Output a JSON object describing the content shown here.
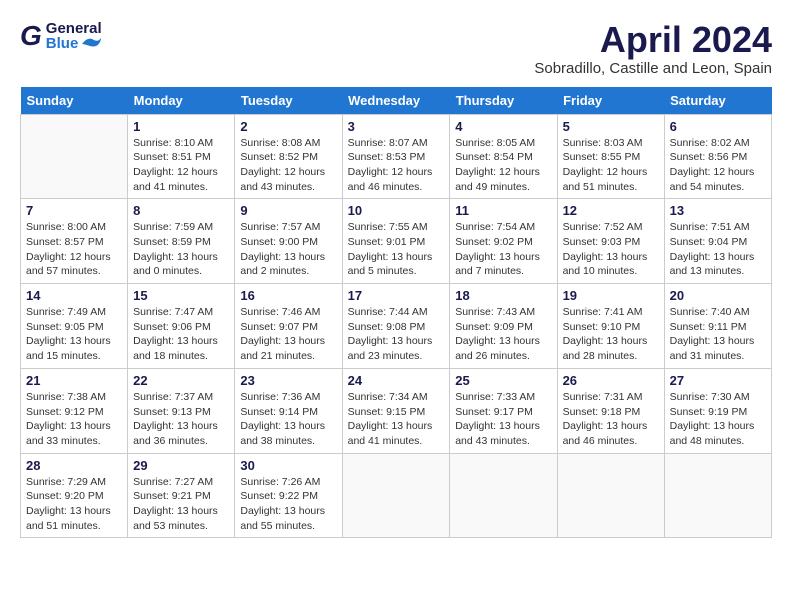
{
  "header": {
    "logo": {
      "general": "General",
      "blue": "Blue"
    },
    "title": "April 2024",
    "location": "Sobradillo, Castille and Leon, Spain"
  },
  "calendar": {
    "days_header": [
      "Sunday",
      "Monday",
      "Tuesday",
      "Wednesday",
      "Thursday",
      "Friday",
      "Saturday"
    ],
    "weeks": [
      [
        {
          "day": "",
          "sunrise": "",
          "sunset": "",
          "daylight": ""
        },
        {
          "day": "1",
          "sunrise": "Sunrise: 8:10 AM",
          "sunset": "Sunset: 8:51 PM",
          "daylight": "Daylight: 12 hours and 41 minutes."
        },
        {
          "day": "2",
          "sunrise": "Sunrise: 8:08 AM",
          "sunset": "Sunset: 8:52 PM",
          "daylight": "Daylight: 12 hours and 43 minutes."
        },
        {
          "day": "3",
          "sunrise": "Sunrise: 8:07 AM",
          "sunset": "Sunset: 8:53 PM",
          "daylight": "Daylight: 12 hours and 46 minutes."
        },
        {
          "day": "4",
          "sunrise": "Sunrise: 8:05 AM",
          "sunset": "Sunset: 8:54 PM",
          "daylight": "Daylight: 12 hours and 49 minutes."
        },
        {
          "day": "5",
          "sunrise": "Sunrise: 8:03 AM",
          "sunset": "Sunset: 8:55 PM",
          "daylight": "Daylight: 12 hours and 51 minutes."
        },
        {
          "day": "6",
          "sunrise": "Sunrise: 8:02 AM",
          "sunset": "Sunset: 8:56 PM",
          "daylight": "Daylight: 12 hours and 54 minutes."
        }
      ],
      [
        {
          "day": "7",
          "sunrise": "Sunrise: 8:00 AM",
          "sunset": "Sunset: 8:57 PM",
          "daylight": "Daylight: 12 hours and 57 minutes."
        },
        {
          "day": "8",
          "sunrise": "Sunrise: 7:59 AM",
          "sunset": "Sunset: 8:59 PM",
          "daylight": "Daylight: 13 hours and 0 minutes."
        },
        {
          "day": "9",
          "sunrise": "Sunrise: 7:57 AM",
          "sunset": "Sunset: 9:00 PM",
          "daylight": "Daylight: 13 hours and 2 minutes."
        },
        {
          "day": "10",
          "sunrise": "Sunrise: 7:55 AM",
          "sunset": "Sunset: 9:01 PM",
          "daylight": "Daylight: 13 hours and 5 minutes."
        },
        {
          "day": "11",
          "sunrise": "Sunrise: 7:54 AM",
          "sunset": "Sunset: 9:02 PM",
          "daylight": "Daylight: 13 hours and 7 minutes."
        },
        {
          "day": "12",
          "sunrise": "Sunrise: 7:52 AM",
          "sunset": "Sunset: 9:03 PM",
          "daylight": "Daylight: 13 hours and 10 minutes."
        },
        {
          "day": "13",
          "sunrise": "Sunrise: 7:51 AM",
          "sunset": "Sunset: 9:04 PM",
          "daylight": "Daylight: 13 hours and 13 minutes."
        }
      ],
      [
        {
          "day": "14",
          "sunrise": "Sunrise: 7:49 AM",
          "sunset": "Sunset: 9:05 PM",
          "daylight": "Daylight: 13 hours and 15 minutes."
        },
        {
          "day": "15",
          "sunrise": "Sunrise: 7:47 AM",
          "sunset": "Sunset: 9:06 PM",
          "daylight": "Daylight: 13 hours and 18 minutes."
        },
        {
          "day": "16",
          "sunrise": "Sunrise: 7:46 AM",
          "sunset": "Sunset: 9:07 PM",
          "daylight": "Daylight: 13 hours and 21 minutes."
        },
        {
          "day": "17",
          "sunrise": "Sunrise: 7:44 AM",
          "sunset": "Sunset: 9:08 PM",
          "daylight": "Daylight: 13 hours and 23 minutes."
        },
        {
          "day": "18",
          "sunrise": "Sunrise: 7:43 AM",
          "sunset": "Sunset: 9:09 PM",
          "daylight": "Daylight: 13 hours and 26 minutes."
        },
        {
          "day": "19",
          "sunrise": "Sunrise: 7:41 AM",
          "sunset": "Sunset: 9:10 PM",
          "daylight": "Daylight: 13 hours and 28 minutes."
        },
        {
          "day": "20",
          "sunrise": "Sunrise: 7:40 AM",
          "sunset": "Sunset: 9:11 PM",
          "daylight": "Daylight: 13 hours and 31 minutes."
        }
      ],
      [
        {
          "day": "21",
          "sunrise": "Sunrise: 7:38 AM",
          "sunset": "Sunset: 9:12 PM",
          "daylight": "Daylight: 13 hours and 33 minutes."
        },
        {
          "day": "22",
          "sunrise": "Sunrise: 7:37 AM",
          "sunset": "Sunset: 9:13 PM",
          "daylight": "Daylight: 13 hours and 36 minutes."
        },
        {
          "day": "23",
          "sunrise": "Sunrise: 7:36 AM",
          "sunset": "Sunset: 9:14 PM",
          "daylight": "Daylight: 13 hours and 38 minutes."
        },
        {
          "day": "24",
          "sunrise": "Sunrise: 7:34 AM",
          "sunset": "Sunset: 9:15 PM",
          "daylight": "Daylight: 13 hours and 41 minutes."
        },
        {
          "day": "25",
          "sunrise": "Sunrise: 7:33 AM",
          "sunset": "Sunset: 9:17 PM",
          "daylight": "Daylight: 13 hours and 43 minutes."
        },
        {
          "day": "26",
          "sunrise": "Sunrise: 7:31 AM",
          "sunset": "Sunset: 9:18 PM",
          "daylight": "Daylight: 13 hours and 46 minutes."
        },
        {
          "day": "27",
          "sunrise": "Sunrise: 7:30 AM",
          "sunset": "Sunset: 9:19 PM",
          "daylight": "Daylight: 13 hours and 48 minutes."
        }
      ],
      [
        {
          "day": "28",
          "sunrise": "Sunrise: 7:29 AM",
          "sunset": "Sunset: 9:20 PM",
          "daylight": "Daylight: 13 hours and 51 minutes."
        },
        {
          "day": "29",
          "sunrise": "Sunrise: 7:27 AM",
          "sunset": "Sunset: 9:21 PM",
          "daylight": "Daylight: 13 hours and 53 minutes."
        },
        {
          "day": "30",
          "sunrise": "Sunrise: 7:26 AM",
          "sunset": "Sunset: 9:22 PM",
          "daylight": "Daylight: 13 hours and 55 minutes."
        },
        {
          "day": "",
          "sunrise": "",
          "sunset": "",
          "daylight": ""
        },
        {
          "day": "",
          "sunrise": "",
          "sunset": "",
          "daylight": ""
        },
        {
          "day": "",
          "sunrise": "",
          "sunset": "",
          "daylight": ""
        },
        {
          "day": "",
          "sunrise": "",
          "sunset": "",
          "daylight": ""
        }
      ]
    ]
  }
}
